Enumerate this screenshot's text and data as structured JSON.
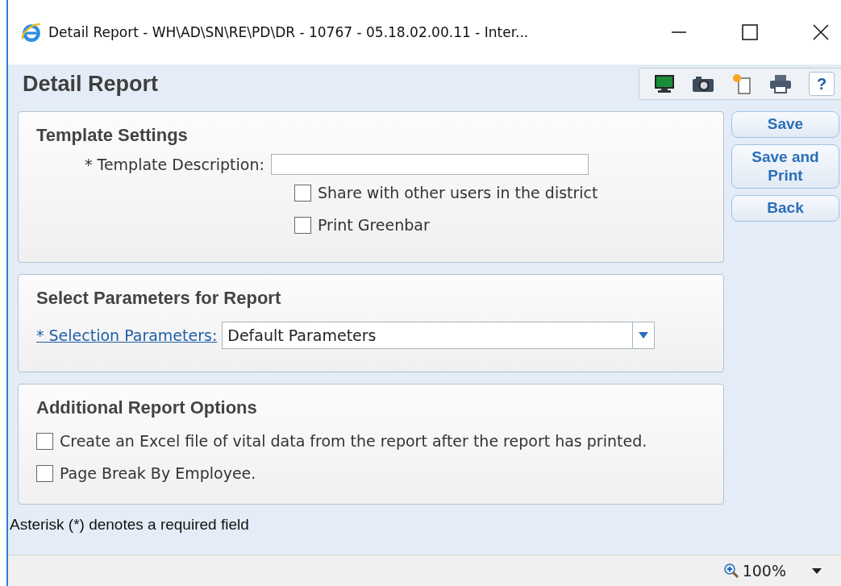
{
  "window": {
    "title": "Detail Report - WH\\AD\\SN\\RE\\PD\\DR - 10767 - 05.18.02.00.11 - Inter..."
  },
  "page_title": "Detail Report",
  "toolbar": [
    {
      "kind": "monitor"
    },
    {
      "kind": "camera"
    },
    {
      "kind": "new"
    },
    {
      "kind": "print"
    },
    {
      "kind": "help",
      "label": "?"
    }
  ],
  "template_settings": {
    "title": "Template Settings",
    "description_label": "* Template Description:",
    "checkboxes": [
      {
        "label": "Share with other users in the district",
        "checked": false
      },
      {
        "label": "Print Greenbar",
        "checked": false
      }
    ]
  },
  "parameters": {
    "title": "Select Parameters for Report",
    "link": "* Selection Parameters:",
    "value": "Default Parameters"
  },
  "options": {
    "title": "Additional Report Options",
    "checkboxes": [
      {
        "label": "Create an Excel file of vital data from the report after the report has printed.",
        "checked": false
      },
      {
        "label": "Page Break By Employee.",
        "checked": false
      }
    ]
  },
  "buttons": [
    {
      "label": "Save"
    },
    {
      "label": "Save and Print"
    },
    {
      "label": "Back"
    }
  ],
  "footnote": "Asterisk (*) denotes a required field",
  "status_bar": {
    "zoom": "100%"
  }
}
